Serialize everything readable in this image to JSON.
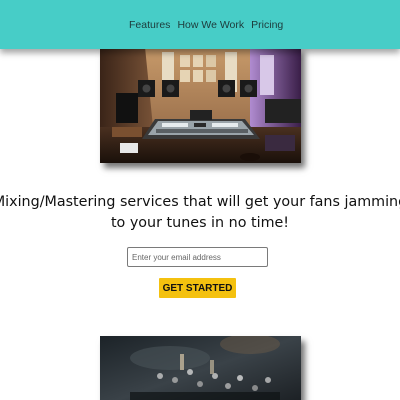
{
  "colors": {
    "header_bg": "#47cdc7",
    "button_bg": "#f4c10f",
    "nav_text": "#1d3b3b"
  },
  "nav": {
    "items": [
      "Features",
      "How We Work",
      "Pricing"
    ]
  },
  "images": {
    "studio": "recording-studio-photo",
    "mixer": "mixing-console-photo"
  },
  "hero": {
    "headline": "Mixing/Mastering services that will get your fans jamming to your tunes in no time!",
    "email_placeholder": "Enter your email address",
    "email_value": "",
    "button_label": "GET STARTED"
  }
}
